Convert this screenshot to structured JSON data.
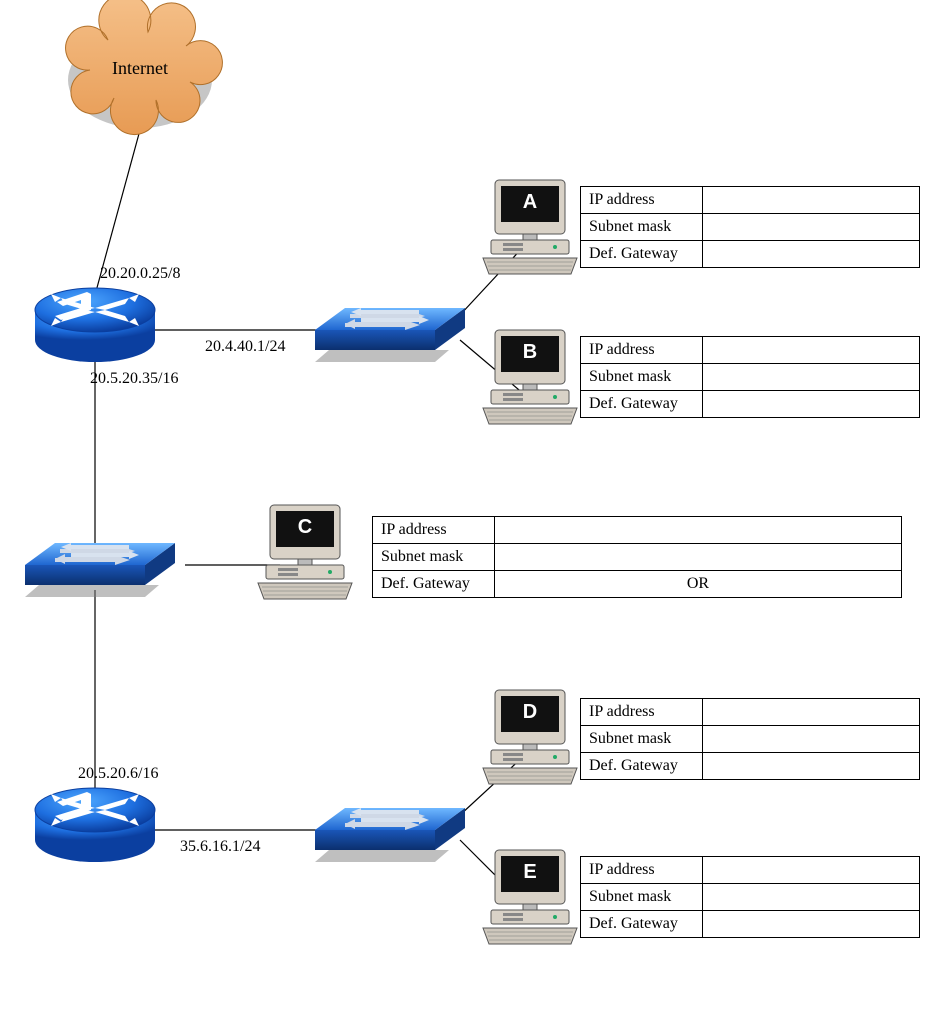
{
  "cloud": {
    "label": "Internet"
  },
  "router1": {
    "if_top": "20.20.0.25/8",
    "if_right": "20.4.40.1/24",
    "if_bottom": "20.5.20.35/16"
  },
  "router2": {
    "if_top": "20.5.20.6/16",
    "if_right": "35.6.16.1/24"
  },
  "hosts": {
    "A": {
      "letter": "A",
      "rows": [
        "IP address",
        "Subnet mask",
        "Def. Gateway"
      ],
      "vals": [
        "",
        "",
        ""
      ]
    },
    "B": {
      "letter": "B",
      "rows": [
        "IP address",
        "Subnet mask",
        "Def. Gateway"
      ],
      "vals": [
        "",
        "",
        ""
      ]
    },
    "C": {
      "letter": "C",
      "rows": [
        "IP address",
        "Subnet mask",
        "Def. Gateway"
      ],
      "vals": [
        "",
        "",
        "OR"
      ]
    },
    "D": {
      "letter": "D",
      "rows": [
        "IP address",
        "Subnet mask",
        "Def. Gateway"
      ],
      "vals": [
        "",
        "",
        ""
      ]
    },
    "E": {
      "letter": "E",
      "rows": [
        "IP address",
        "Subnet mask",
        "Def. Gateway"
      ],
      "vals": [
        "",
        "",
        ""
      ]
    }
  }
}
